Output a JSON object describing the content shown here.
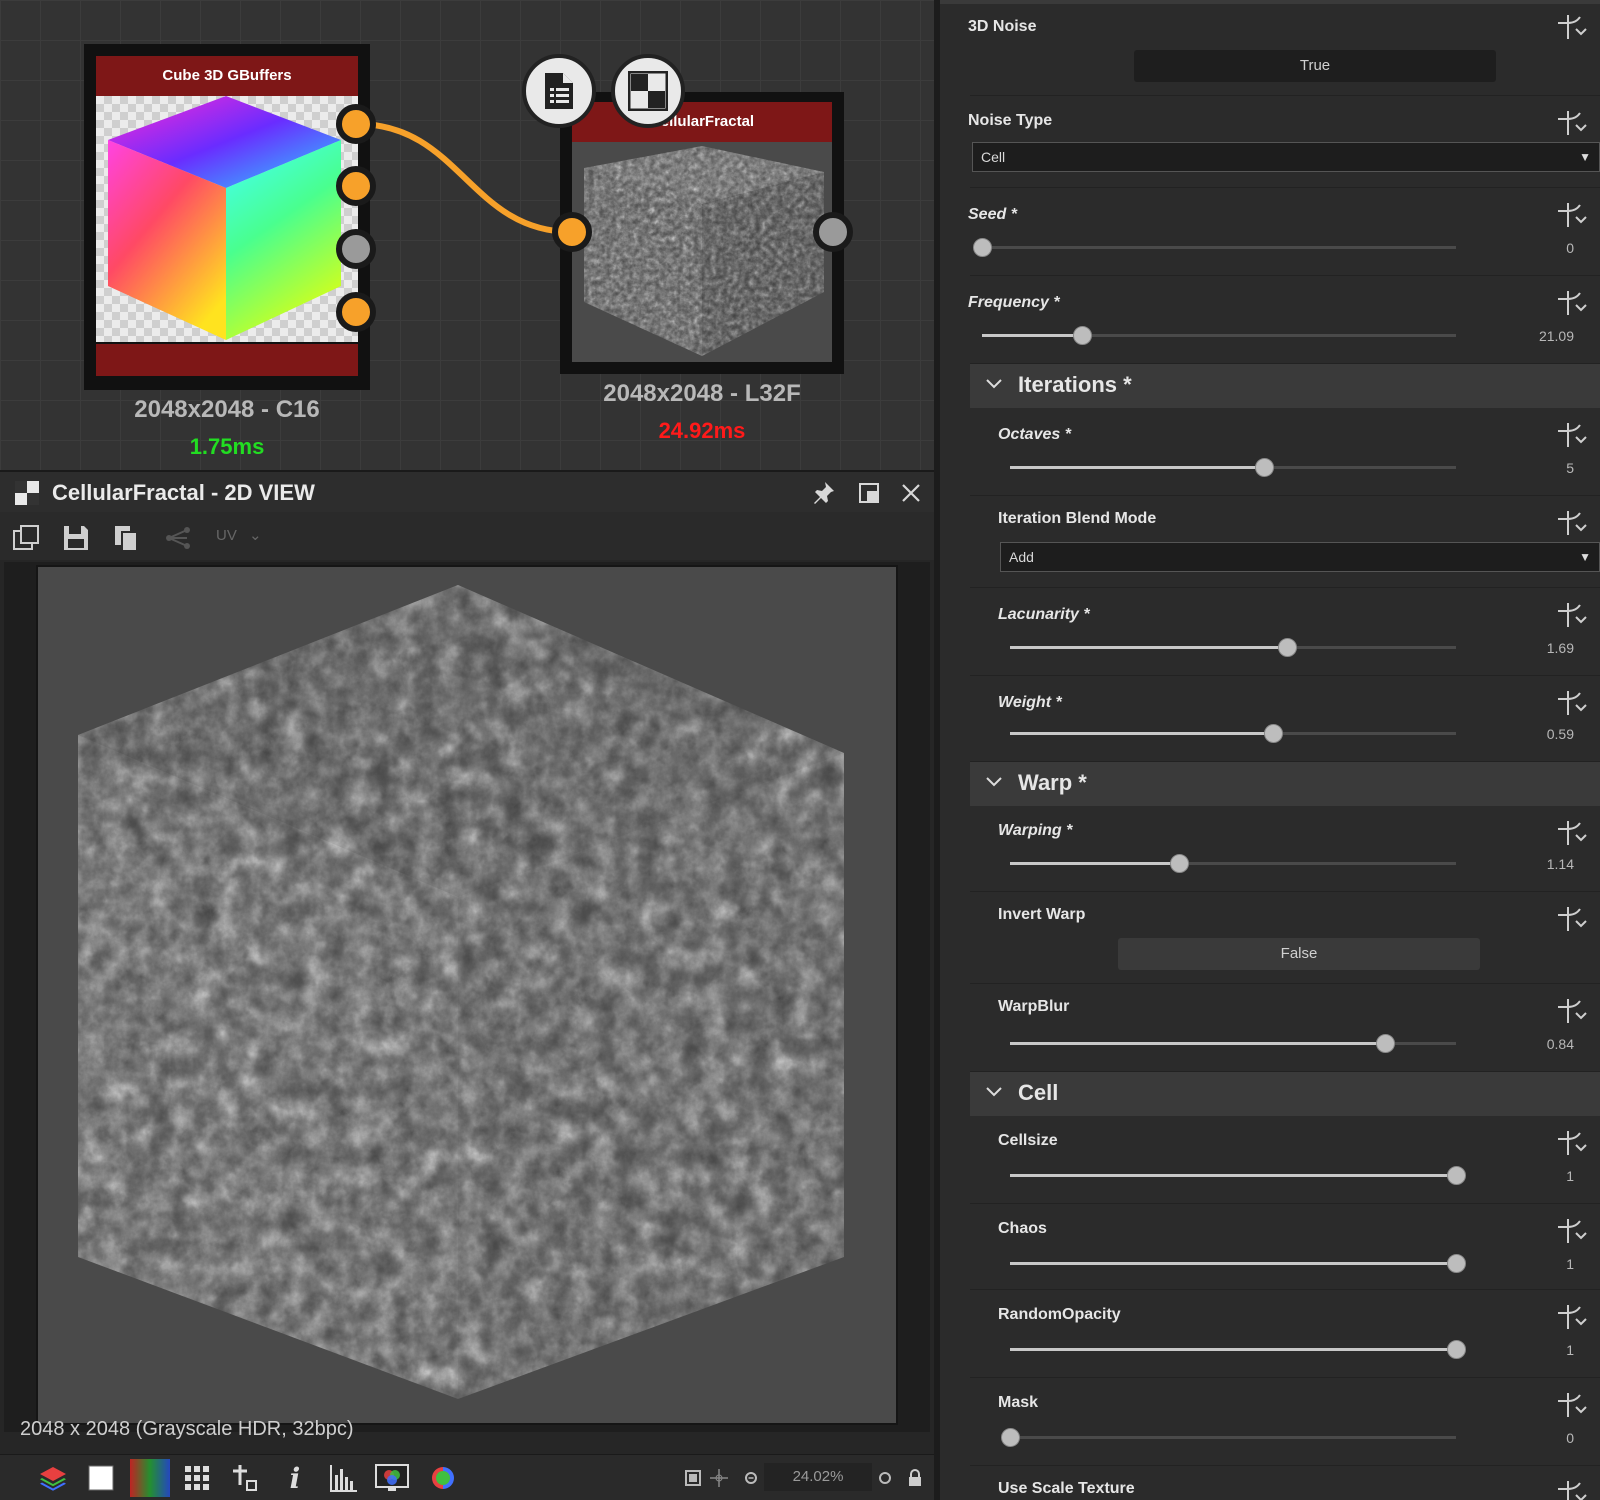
{
  "graph": {
    "node1": {
      "title": "Cube 3D GBuffers",
      "resolution": "2048x2048 - C16",
      "time": "1.75ms",
      "time_color": "#22dd22"
    },
    "node2": {
      "title": "CellularFractal",
      "resolution": "2048x2048 - L32F",
      "time": "24.92ms",
      "time_color": "#ff1a1a"
    },
    "accent": "#f7a12a",
    "header_color": "#7e1717"
  },
  "view2d": {
    "title": "CellularFractal - 2D VIEW",
    "toolbar": {
      "uv_label": "UV"
    },
    "info": "2048 x 2048 (Grayscale HDR, 32bpc)",
    "zoom": "24.02%"
  },
  "panel": {
    "noise3d": {
      "label": "3D Noise",
      "value": "True"
    },
    "noise_type": {
      "label": "Noise Type",
      "value": "Cell"
    },
    "seed": {
      "label": "Seed *",
      "value": "0",
      "fraction": 0.0
    },
    "frequency": {
      "label": "Frequency *",
      "value": "21.09",
      "fraction": 0.21
    },
    "iterations": {
      "title": "Iterations *",
      "octaves": {
        "label": "Octaves *",
        "value": "5",
        "fraction": 0.57
      },
      "blend": {
        "label": "Iteration Blend Mode",
        "value": "Add"
      },
      "lacunarity": {
        "label": "Lacunarity *",
        "value": "1.69",
        "fraction": 0.62
      },
      "weight": {
        "label": "Weight *",
        "value": "0.59",
        "fraction": 0.59
      }
    },
    "warp": {
      "title": "Warp *",
      "warping": {
        "label": "Warping *",
        "value": "1.14",
        "fraction": 0.38
      },
      "invert": {
        "label": "Invert Warp",
        "value": "False"
      },
      "warpblur": {
        "label": "WarpBlur",
        "value": "0.84",
        "fraction": 0.84
      }
    },
    "cell": {
      "title": "Cell",
      "cellsize": {
        "label": "Cellsize",
        "value": "1",
        "fraction": 1.0
      },
      "chaos": {
        "label": "Chaos",
        "value": "1",
        "fraction": 1.0
      },
      "randomopacity": {
        "label": "RandomOpacity",
        "value": "1",
        "fraction": 1.0
      },
      "mask": {
        "label": "Mask",
        "value": "0",
        "fraction": 0.0
      },
      "usescale": {
        "label": "Use Scale Texture"
      }
    }
  }
}
